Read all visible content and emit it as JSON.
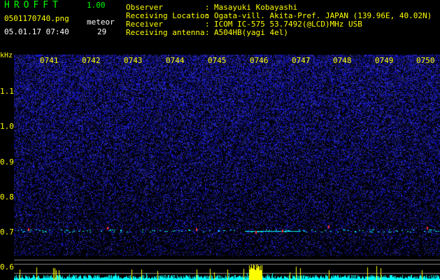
{
  "header": {
    "app_title": "HROFFT",
    "app_version": "1.00",
    "file_name": "0501170740.png",
    "timestamp": "05.01.17 07:40",
    "meteor_label": "meteor",
    "meteor_count": "29"
  },
  "info": [
    {
      "label": "Observer",
      "value": "Masayuki Kobayashi"
    },
    {
      "label": "Receiving Location",
      "value": "Ogata-vill. Akita-Pref. JAPAN (139.96E, 40.02N)"
    },
    {
      "label": "Receiver",
      "value": "ICOM IC-575 53.7492(@LCD)MHz USB"
    },
    {
      "label": "Receiving antenna",
      "value": "A504HB(yagi 4el)"
    }
  ],
  "info_separator": ":",
  "spectrogram": {
    "frequency_unit": "kHz",
    "frequency_ticks": [
      "1.1",
      "1.0",
      "0.9",
      "0.8",
      "0.7",
      "0.6"
    ],
    "time_ticks": [
      "0741",
      "0742",
      "0743",
      "0744",
      "0745",
      "0746",
      "0747",
      "0748",
      "0749",
      "0750"
    ],
    "colors": {
      "background": "#000000",
      "noise": "#2a2aff",
      "signal": "#ff3030",
      "echo": "#00ffff",
      "level": "#ffff00"
    }
  }
}
